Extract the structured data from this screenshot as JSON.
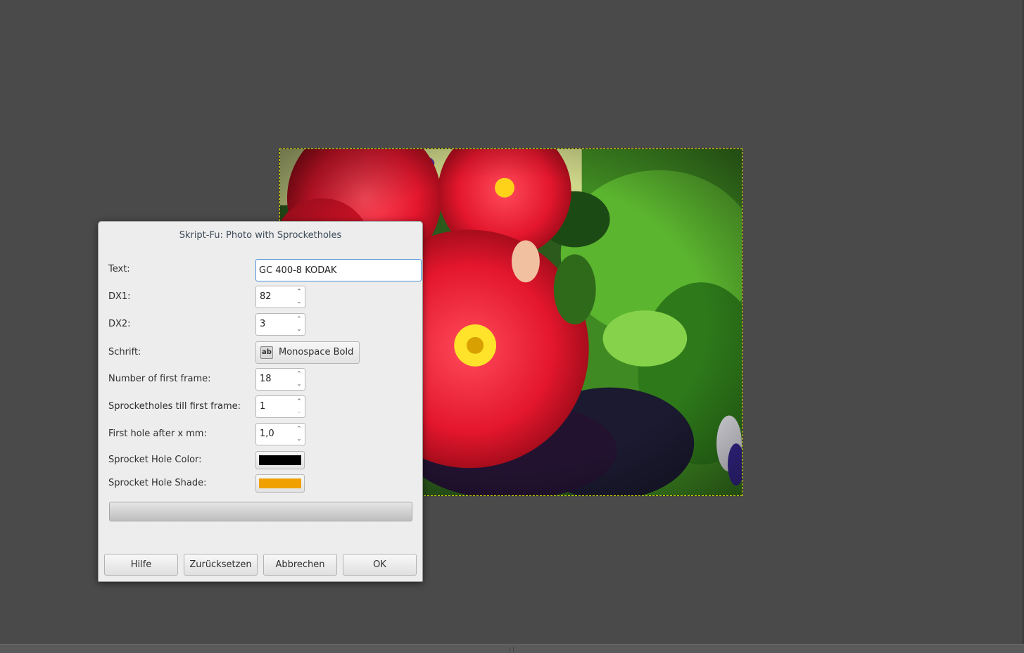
{
  "dialog": {
    "title": "Skript-Fu: Photo with Sprocketholes",
    "fields": {
      "text": {
        "label": "Text:",
        "value": "GC 400-8 KODAK"
      },
      "dx1": {
        "label": "DX1:",
        "value": "82"
      },
      "dx2": {
        "label": "DX2:",
        "value": "3"
      },
      "font": {
        "label": "Schrift:",
        "value": "Monospace Bold",
        "icon": "font-icon"
      },
      "first_frame": {
        "label": "Number of first frame:",
        "value": "18"
      },
      "sprocketholes": {
        "label": "Sprocketholes till first frame:",
        "value": "1"
      },
      "first_hole": {
        "label": "First hole after x mm:",
        "value": "1,0"
      },
      "hole_color": {
        "label": "Sprocket Hole Color:",
        "color": "#000000"
      },
      "hole_shade": {
        "label": "Sprocket Hole Shade:",
        "color": "#f0a000"
      }
    },
    "buttons": {
      "help": "Hilfe",
      "reset": "Zurücksetzen",
      "cancel": "Abbrechen",
      "ok": "OK"
    }
  },
  "canvas": {
    "selection_color": "#e8e000",
    "image_subject": "red-dahlia-flowers-photo"
  }
}
